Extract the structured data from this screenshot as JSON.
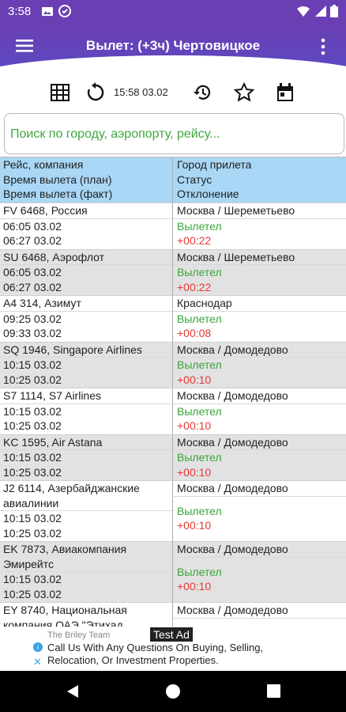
{
  "status_bar": {
    "time": "3:58"
  },
  "app_bar": {
    "title": "Вылет: (+3ч) Чертовицкое"
  },
  "toolbar": {
    "updated": "15:58 03.02"
  },
  "search": {
    "placeholder": "Поиск по городу, аэропорту, рейсу..."
  },
  "table": {
    "headers": {
      "left": [
        "Рейс, компания",
        "Время вылета (план)",
        "Время вылета (факт)"
      ],
      "right": [
        "Город прилета",
        "Статус",
        "Отклонение"
      ]
    },
    "rows": [
      {
        "flight": [
          "FV 6468, Россия"
        ],
        "plan": "06:05 03.02",
        "fact": "06:27 03.02",
        "city": "Москва / Шереметьево",
        "status": "Вылетел",
        "deviation": "+00:22"
      },
      {
        "flight": [
          "SU 6468, Аэрофлот"
        ],
        "plan": "06:05 03.02",
        "fact": "06:27 03.02",
        "city": "Москва / Шереметьево",
        "status": "Вылетел",
        "deviation": "+00:22"
      },
      {
        "flight": [
          "A4 314, Азимут"
        ],
        "plan": "09:25 03.02",
        "fact": "09:33 03.02",
        "city": "Краснодар",
        "status": "Вылетел",
        "deviation": "+00:08"
      },
      {
        "flight": [
          "SQ 1946, Singapore Airlines"
        ],
        "plan": "10:15 03.02",
        "fact": "10:25 03.02",
        "city": "Москва / Домодедово",
        "status": "Вылетел",
        "deviation": "+00:10"
      },
      {
        "flight": [
          "S7 1114, S7 Airlines"
        ],
        "plan": "10:15 03.02",
        "fact": "10:25 03.02",
        "city": "Москва / Домодедово",
        "status": "Вылетел",
        "deviation": "+00:10"
      },
      {
        "flight": [
          "KC 1595, Air Astana"
        ],
        "plan": "10:15 03.02",
        "fact": "10:25 03.02",
        "city": "Москва / Домодедово",
        "status": "Вылетел",
        "deviation": "+00:10"
      },
      {
        "flight": [
          "J2 6114, Азербайджанские",
          "авиалинии"
        ],
        "plan": "10:15 03.02",
        "fact": "10:25 03.02",
        "city": "Москва / Домодедово",
        "status": "Вылетел",
        "deviation": "+00:10"
      },
      {
        "flight": [
          "EK 7873, Авиакомпания",
          "Эмирейтс"
        ],
        "plan": "10:15 03.02",
        "fact": "10:25 03.02",
        "city": "Москва / Домодедово",
        "status": "Вылетел",
        "deviation": "+00:10"
      },
      {
        "flight": [
          "EY 8740, Национальная",
          "компания ОАЭ \"Этихад"
        ],
        "plan": "",
        "fact": "",
        "city": "Москва / Домодедово",
        "status": "",
        "deviation": ""
      }
    ]
  },
  "ad": {
    "advertiser": "The Briley Team",
    "text": "Call Us With Any Questions On Buying, Selling, Relocation, Or Investment Properties.",
    "badge": "Test Ad"
  },
  "colors": {
    "app_bar": "#6a3fb3",
    "header_row": "#a9d7f5",
    "status_ok": "#39a539",
    "deviation": "#e53935"
  }
}
